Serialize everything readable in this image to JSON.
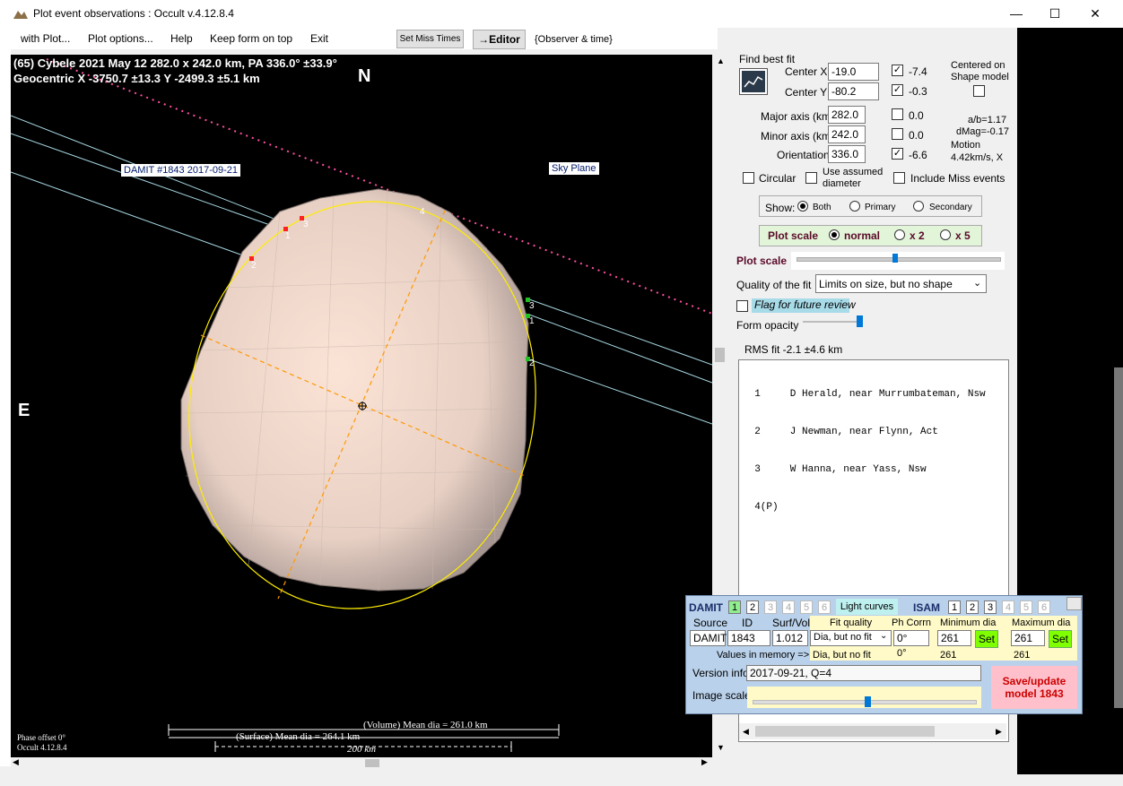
{
  "window": {
    "title": "Plot event observations : Occult v.4.12.8.4",
    "minimize": "—",
    "maximize": "☐",
    "close": "✕"
  },
  "menu": {
    "items": [
      "with Plot...",
      "Plot options...",
      "Help",
      "Keep form on top",
      "Exit"
    ],
    "set_miss_times": "Set Miss Times",
    "editor": "→Editor",
    "observer_time": "{Observer & time}"
  },
  "plot": {
    "header_line1": "(65) Cybele  2021 May 12   282.0 x 242.0 km,  PA 336.0° ±33.9°",
    "header_line2": "Geocentric  X  -3750.7 ±13.3  Y -2499.3 ±5.1 km",
    "north": "N",
    "east": "E",
    "damit_label": "DAMIT #1843 2017-09-21",
    "sky_plane": "Sky Plane",
    "chord_labels": [
      "1",
      "3",
      "2",
      "4",
      "3",
      "1",
      "2"
    ],
    "volume_dia": "(Volume) Mean dia = 261.0 km",
    "surface_dia": "(Surface) Mean dia = 264.1 km",
    "scale_text": "200 km",
    "phase_offset": "Phase offset 0°",
    "occult_version": "Occult 4.12.8.4"
  },
  "fit": {
    "find_best_fit": "Find best fit",
    "center_x_label": "Center X",
    "center_x": "-19.0",
    "center_x_adj": "-7.4",
    "center_y_label": "Center Y",
    "center_y": "-80.2",
    "center_y_adj": "-0.3",
    "major_label": "Major axis (km)",
    "major": "282.0",
    "major_adj": "0.0",
    "minor_label": "Minor axis (km)",
    "minor": "242.0",
    "minor_adj": "0.0",
    "orient_label": "Orientation",
    "orient": "336.0",
    "orient_adj": "-6.6",
    "centered_on": "Centered on",
    "shape_model": "Shape model",
    "ab": "a/b=1.17",
    "dmag": "dMag=-0.17",
    "motion": "Motion",
    "motion_val": "4.42km/s, X",
    "circular": "Circular",
    "use_assumed": "Use assumed",
    "diameter": "diameter",
    "include_miss": "Include Miss events",
    "show": "Show:",
    "both": "Both",
    "primary": "Primary",
    "secondary": "Secondary",
    "plot_scale": "Plot scale",
    "normal": "normal",
    "x2": "x 2",
    "x5": "x 5",
    "plot_scale2": "Plot scale",
    "quality_label": "Quality of the fit",
    "quality": "Limits on size, but no shape",
    "flag": "Flag for future review",
    "form_opacity": "Form opacity",
    "rms": "RMS fit -2.1 ±4.6 km"
  },
  "observers": [
    "  1     D Herald, near Murrumbateman, Nsw",
    "  2     J Newman, near Flynn, Act",
    "  3     W Hanna, near Yass, Nsw",
    "  4(P)"
  ],
  "damit": {
    "damit": "DAMIT",
    "tabs": [
      "1",
      "2",
      "3",
      "4",
      "5",
      "6"
    ],
    "light_curves": "Light curves",
    "isam": "ISAM",
    "source": "Source",
    "id": "ID",
    "surf_vol": "Surf/Vol",
    "fit_quality": "Fit quality",
    "ph_corrn": "Ph Corrn",
    "min_dia": "Minimum dia",
    "max_dia": "Maximum dia",
    "source_val": "DAMIT",
    "id_val": "1843",
    "surf_val": "1.012",
    "fitq_val": "Dia, but no fit",
    "ph_val": "0°",
    "min_val": "261",
    "max_val": "261",
    "set": "Set",
    "values_mem": "Values in memory =>",
    "mem_fitq": "Dia, but no fit",
    "mem_ph": "0°",
    "mem_min": "261",
    "mem_max": "261",
    "version_info": "Version info",
    "version_val": "2017-09-21, Q=4",
    "image_scale": "Image scale",
    "save": "Save/update model 1843"
  }
}
